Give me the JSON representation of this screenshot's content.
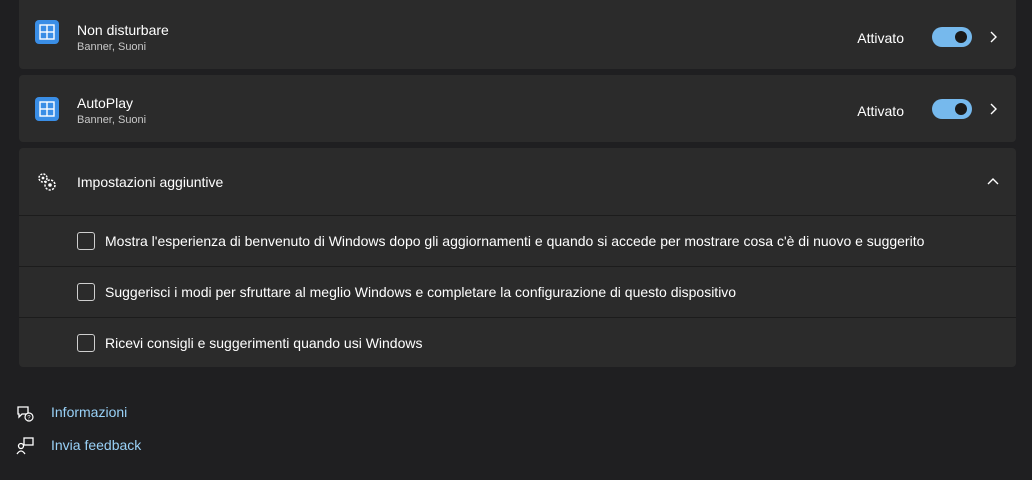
{
  "rows": [
    {
      "title": "Non disturbare",
      "subtitle": "Banner, Suoni",
      "state": "Attivato",
      "enabled": true
    },
    {
      "title": "AutoPlay",
      "subtitle": "Banner, Suoni",
      "state": "Attivato",
      "enabled": true
    }
  ],
  "additional": {
    "title": "Impostazioni aggiuntive",
    "options": [
      {
        "label": "Mostra l'esperienza di benvenuto di Windows dopo gli aggiornamenti e quando si accede per mostrare cosa c'è di nuovo e suggerito",
        "checked": false
      },
      {
        "label": "Suggerisci i modi per sfruttare al meglio Windows e completare la configurazione di questo dispositivo",
        "checked": false
      },
      {
        "label": "Ricevi consigli e suggerimenti quando usi Windows",
        "checked": false
      }
    ]
  },
  "links": {
    "info": "Informazioni",
    "feedback": "Invia feedback"
  },
  "colors": {
    "accent": "#76b9ed",
    "link": "#99d1f7",
    "card": "#2b2b2b",
    "background": "#1f1f21"
  }
}
